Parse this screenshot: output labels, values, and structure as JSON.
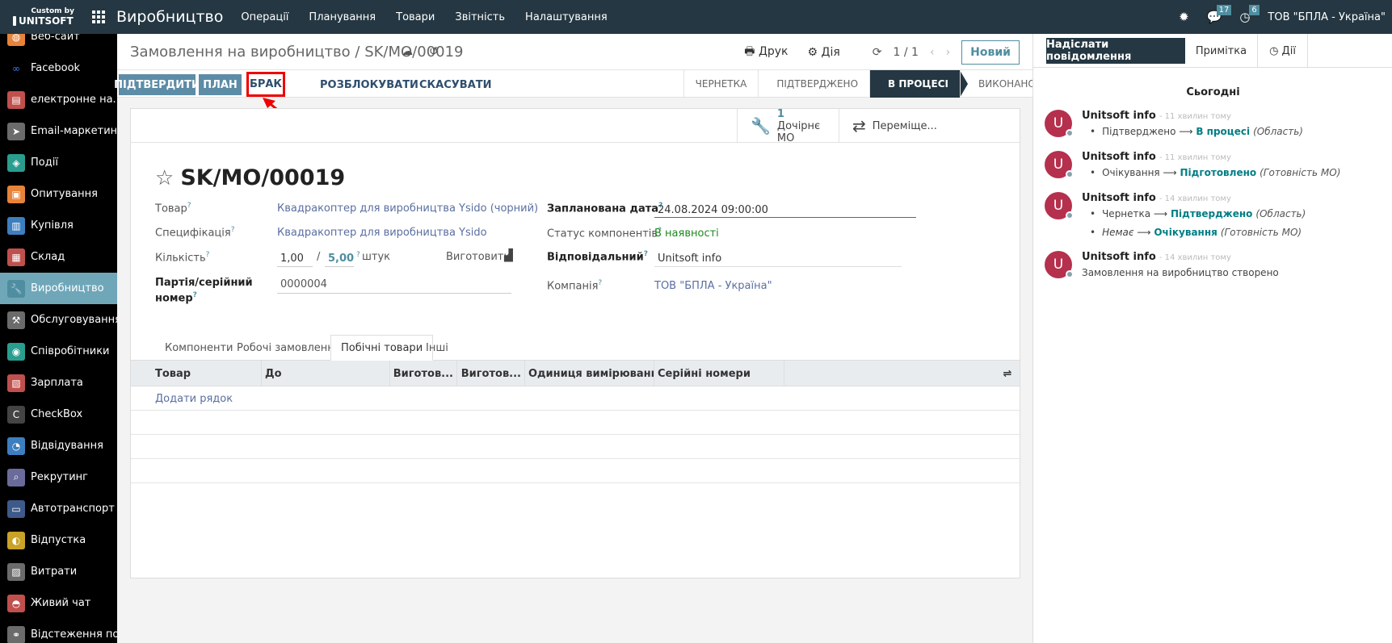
{
  "navbar": {
    "brand_top": "Custom by",
    "brand_bottom": "UNITSOFT",
    "app_title": "Виробництво",
    "menu": [
      "Операції",
      "Планування",
      "Товари",
      "Звітність",
      "Налаштування"
    ],
    "messages_badge": "17",
    "activities_badge": "6",
    "company": "ТОВ \"БПЛА - Україна\""
  },
  "sidebar": {
    "items": [
      {
        "label": "Веб-сайт",
        "icon": "globe-icon",
        "color": "#e8833a"
      },
      {
        "label": "Facebook",
        "icon": "meta-icon",
        "color": "#000000"
      },
      {
        "label": "електронне на...",
        "icon": "elearning-icon",
        "color": "#c0504d"
      },
      {
        "label": "Email-маркетинг",
        "icon": "paper-plane-icon",
        "color": "#6b6b6b"
      },
      {
        "label": "Події",
        "icon": "ticket-icon",
        "color": "#2a9d8f"
      },
      {
        "label": "Опитування",
        "icon": "clipboard-icon",
        "color": "#e8833a"
      },
      {
        "label": "Купівля",
        "icon": "purchase-icon",
        "color": "#3d7ebf"
      },
      {
        "label": "Склад",
        "icon": "box-icon",
        "color": "#c0504d"
      },
      {
        "label": "Виробництво",
        "icon": "wrench-icon",
        "color": "#4f8ea0",
        "active": true
      },
      {
        "label": "Обслуговування",
        "icon": "hammer-icon",
        "color": "#6b6b6b"
      },
      {
        "label": "Співробітники",
        "icon": "people-icon",
        "color": "#2a9d8f"
      },
      {
        "label": "Зарплата",
        "icon": "payroll-icon",
        "color": "#c0504d"
      },
      {
        "label": "CheckBox",
        "icon": "checkbox-c-icon",
        "color": "#444444"
      },
      {
        "label": "Відвідування",
        "icon": "attendance-icon",
        "color": "#3d7ebf"
      },
      {
        "label": "Рекрутинг",
        "icon": "magnifier-icon",
        "color": "#6b6b9b"
      },
      {
        "label": "Автотранспорт",
        "icon": "car-icon",
        "color": "#3d5a8a"
      },
      {
        "label": "Відпустка",
        "icon": "leave-icon",
        "color": "#c9a227"
      },
      {
        "label": "Витрати",
        "icon": "expense-icon",
        "color": "#6b6b6b"
      },
      {
        "label": "Живий чат",
        "icon": "chat-icon",
        "color": "#c0504d"
      },
      {
        "label": "Відстеження по...",
        "icon": "link-icon",
        "color": "#6b6b6b"
      }
    ]
  },
  "control_panel": {
    "breadcrumb_parent": "Замовлення на виробництво",
    "breadcrumb_sep": "/",
    "breadcrumb_current": "SK/MO/00019",
    "print_label": "Друк",
    "action_label": "Дія",
    "pager": "1 / 1",
    "new_label": "Новий",
    "buttons": {
      "confirm": "ПІДТВЕРДИТИ",
      "plan": "ПЛАН",
      "scrap": "БРАК",
      "unblock": "РОЗБЛОКУВАТИ",
      "cancel": "СКАСУВАТИ"
    },
    "stages": [
      {
        "label": "ЧЕРНЕТКА",
        "active": false
      },
      {
        "label": "ПІДТВЕРДЖЕНО",
        "active": false
      },
      {
        "label": "В ПРОЦЕСІ",
        "active": true
      },
      {
        "label": "ВИКОНАНО",
        "active": false
      }
    ]
  },
  "form": {
    "stat_child_count": "1",
    "stat_child_label": "Дочірнє МО",
    "stat_transfers_label": "Переміще...",
    "title": "SK/MO/00019",
    "fields": {
      "product_label": "Товар",
      "product_value": "Квадракоптер для виробництва Ysido (чорний)",
      "bom_label": "Специфікація",
      "bom_value": "Квадракоптер для виробництва Ysido",
      "qty_label": "Кількість",
      "qty_produced": "1,00",
      "qty_sep": "/",
      "qty_total": "5,00",
      "qty_uom": "штук",
      "produce_label": "Виготовити",
      "lot_label_1": "Партія/серійний",
      "lot_label_2": "номер",
      "lot_value": "0000004",
      "date_label": "Запланована дата",
      "date_value": "24.08.2024 09:00:00",
      "components_status_label": "Статус компонентів",
      "components_status_value": "В наявності",
      "responsible_label": "Відповідальний",
      "responsible_value": "Unitsoft info",
      "company_label": "Компанія",
      "company_value": "ТОВ \"БПЛА - Україна\""
    },
    "tabs": [
      "Компоненти",
      "Робочі замовлення",
      "Побічні товари",
      "Інші"
    ],
    "table_columns": [
      "Товар",
      "До",
      "Виготов...",
      "Виготов...",
      "Одиниця вимірювання",
      "Серійні номери"
    ],
    "add_line": "Додати рядок"
  },
  "chatter": {
    "send_message": "Надіслати повідомлення",
    "note": "Примітка",
    "activities": "Дії",
    "today": "Сьогодні",
    "messages": [
      {
        "author": "Unitsoft info",
        "time": "- 11 хвилин тому",
        "changes": [
          {
            "old": "Підтверджено",
            "new": "В процесі",
            "field": "(Область)"
          }
        ]
      },
      {
        "author": "Unitsoft info",
        "time": "- 11 хвилин тому",
        "changes": [
          {
            "old": "Очікування",
            "new": "Підготовлено",
            "field": "(Готовність МО)"
          }
        ]
      },
      {
        "author": "Unitsoft info",
        "time": "- 14 хвилин тому",
        "changes": [
          {
            "old": "Чернетка",
            "new": "Підтверджено",
            "field": "(Область)"
          },
          {
            "old": "Немає",
            "new": "Очікування",
            "field": "(Готовність МО)"
          }
        ]
      },
      {
        "author": "Unitsoft info",
        "time": "- 14 хвилин тому",
        "body": "Замовлення на виробництво створено"
      }
    ]
  }
}
